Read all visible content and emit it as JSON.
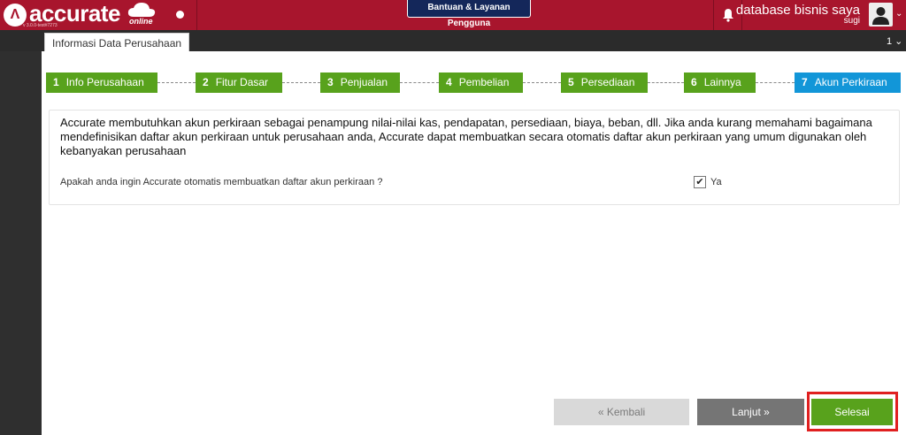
{
  "app": {
    "logo_mark": "Λ",
    "logo_word": "accurate",
    "logo_sub": "online",
    "version": "v 3.0.0-test#7273",
    "help_button": "Bantuan & Layanan Pengguna",
    "database_name": "database bisnis saya",
    "user_name": "sugi",
    "tab_count": "1 ⌄"
  },
  "tab": {
    "label": "Informasi Data Perusahaan"
  },
  "steps": [
    {
      "num": "1",
      "label": "Info Perusahaan"
    },
    {
      "num": "2",
      "label": "Fitur Dasar"
    },
    {
      "num": "3",
      "label": "Penjualan"
    },
    {
      "num": "4",
      "label": "Pembelian"
    },
    {
      "num": "5",
      "label": "Persediaan"
    },
    {
      "num": "6",
      "label": "Lainnya"
    },
    {
      "num": "7",
      "label": "Akun Perkiraan"
    }
  ],
  "active_step": 7,
  "panel": {
    "description": "Accurate membutuhkan akun perkiraan sebagai penampung nilai-nilai kas, pendapatan, persediaan, biaya, beban, dll. Jika anda kurang memahami bagaimana mendefinisikan daftar akun perkiraan untuk perusahaan anda, Accurate dapat membuatkan secara otomatis daftar akun perkiraan yang umum digunakan oleh kebanyakan perusahaan",
    "question": "Apakah anda ingin Accurate otomatis membuatkan daftar akun perkiraan ?",
    "checkbox_checked": true,
    "checkbox_mark": "✔",
    "checkbox_label": "Ya"
  },
  "buttons": {
    "back": "« Kembali",
    "next": "Lanjut »",
    "finish": "Selesai"
  },
  "colors": {
    "brand": "#a8152d",
    "step_done": "#58a21c",
    "step_active": "#1296d8",
    "highlight": "#e02020"
  }
}
